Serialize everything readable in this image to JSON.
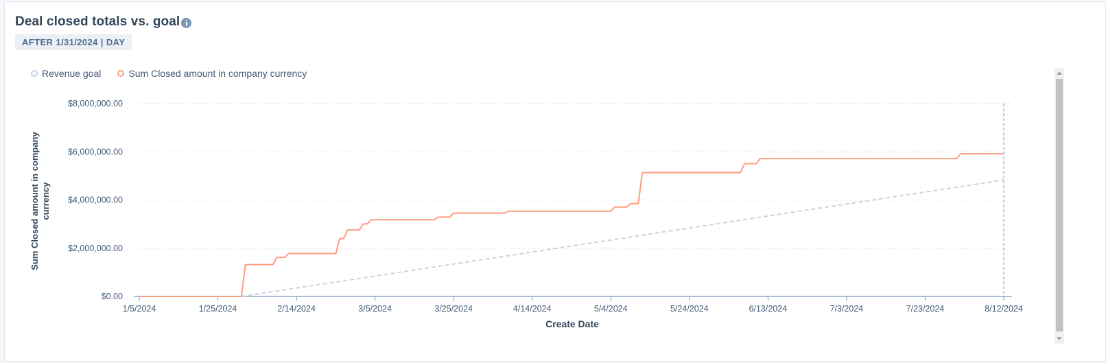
{
  "card": {
    "title": "Deal closed totals vs. goal",
    "filter_label": "AFTER 1/31/2024 | DAY"
  },
  "colors": {
    "revenue_goal": "#c7d4e2",
    "sum_closed": "#ff9c7e",
    "axis": "#425b76",
    "grid": "#dfe3eb"
  },
  "chart_data": {
    "type": "line",
    "xlabel": "Create Date",
    "ylabel": "Sum Closed amount in company currency",
    "x_range": [
      "2024-01-05",
      "2024-08-12"
    ],
    "ylim": [
      0,
      8000000
    ],
    "y_ticks": [
      0,
      2000000,
      4000000,
      6000000,
      8000000
    ],
    "y_tick_labels": [
      "$0.00",
      "$2,000,000.00",
      "$4,000,000.00",
      "$6,000,000.00",
      "$8,000,000.00"
    ],
    "x_ticks": [
      "2024-01-05",
      "2024-01-25",
      "2024-02-14",
      "2024-03-05",
      "2024-03-25",
      "2024-04-14",
      "2024-05-04",
      "2024-05-24",
      "2024-06-13",
      "2024-07-03",
      "2024-07-23",
      "2024-08-12"
    ],
    "x_tick_labels": [
      "1/5/2024",
      "1/25/2024",
      "2/14/2024",
      "3/5/2024",
      "3/25/2024",
      "4/14/2024",
      "5/4/2024",
      "5/24/2024",
      "6/13/2024",
      "7/3/2024",
      "7/23/2024",
      "8/12/2024"
    ],
    "grid": true,
    "legend_position": "top-left",
    "series": [
      {
        "name": "Revenue goal",
        "style": "dashed",
        "points": [
          [
            "2024-01-31",
            0
          ],
          [
            "2024-08-12",
            4830000
          ]
        ]
      },
      {
        "name": "Sum Closed amount in company currency",
        "style": "solid",
        "points": [
          [
            "2024-01-05",
            0
          ],
          [
            "2024-01-31",
            0
          ],
          [
            "2024-02-01",
            1320000
          ],
          [
            "2024-02-08",
            1320000
          ],
          [
            "2024-02-09",
            1620000
          ],
          [
            "2024-02-11",
            1620000
          ],
          [
            "2024-02-12",
            1780000
          ],
          [
            "2024-02-24",
            1780000
          ],
          [
            "2024-02-25",
            2400000
          ],
          [
            "2024-02-26",
            2400000
          ],
          [
            "2024-02-27",
            2760000
          ],
          [
            "2024-03-01",
            2760000
          ],
          [
            "2024-03-02",
            3010000
          ],
          [
            "2024-03-03",
            3010000
          ],
          [
            "2024-03-04",
            3180000
          ],
          [
            "2024-03-20",
            3180000
          ],
          [
            "2024-03-21",
            3290000
          ],
          [
            "2024-03-24",
            3290000
          ],
          [
            "2024-03-25",
            3460000
          ],
          [
            "2024-04-07",
            3460000
          ],
          [
            "2024-04-08",
            3540000
          ],
          [
            "2024-05-04",
            3540000
          ],
          [
            "2024-05-05",
            3710000
          ],
          [
            "2024-05-08",
            3710000
          ],
          [
            "2024-05-09",
            3850000
          ],
          [
            "2024-05-11",
            3850000
          ],
          [
            "2024-05-12",
            5140000
          ],
          [
            "2024-06-06",
            5140000
          ],
          [
            "2024-06-07",
            5510000
          ],
          [
            "2024-06-10",
            5510000
          ],
          [
            "2024-06-11",
            5720000
          ],
          [
            "2024-07-31",
            5720000
          ],
          [
            "2024-08-01",
            5920000
          ],
          [
            "2024-08-12",
            5920000
          ]
        ]
      }
    ]
  }
}
